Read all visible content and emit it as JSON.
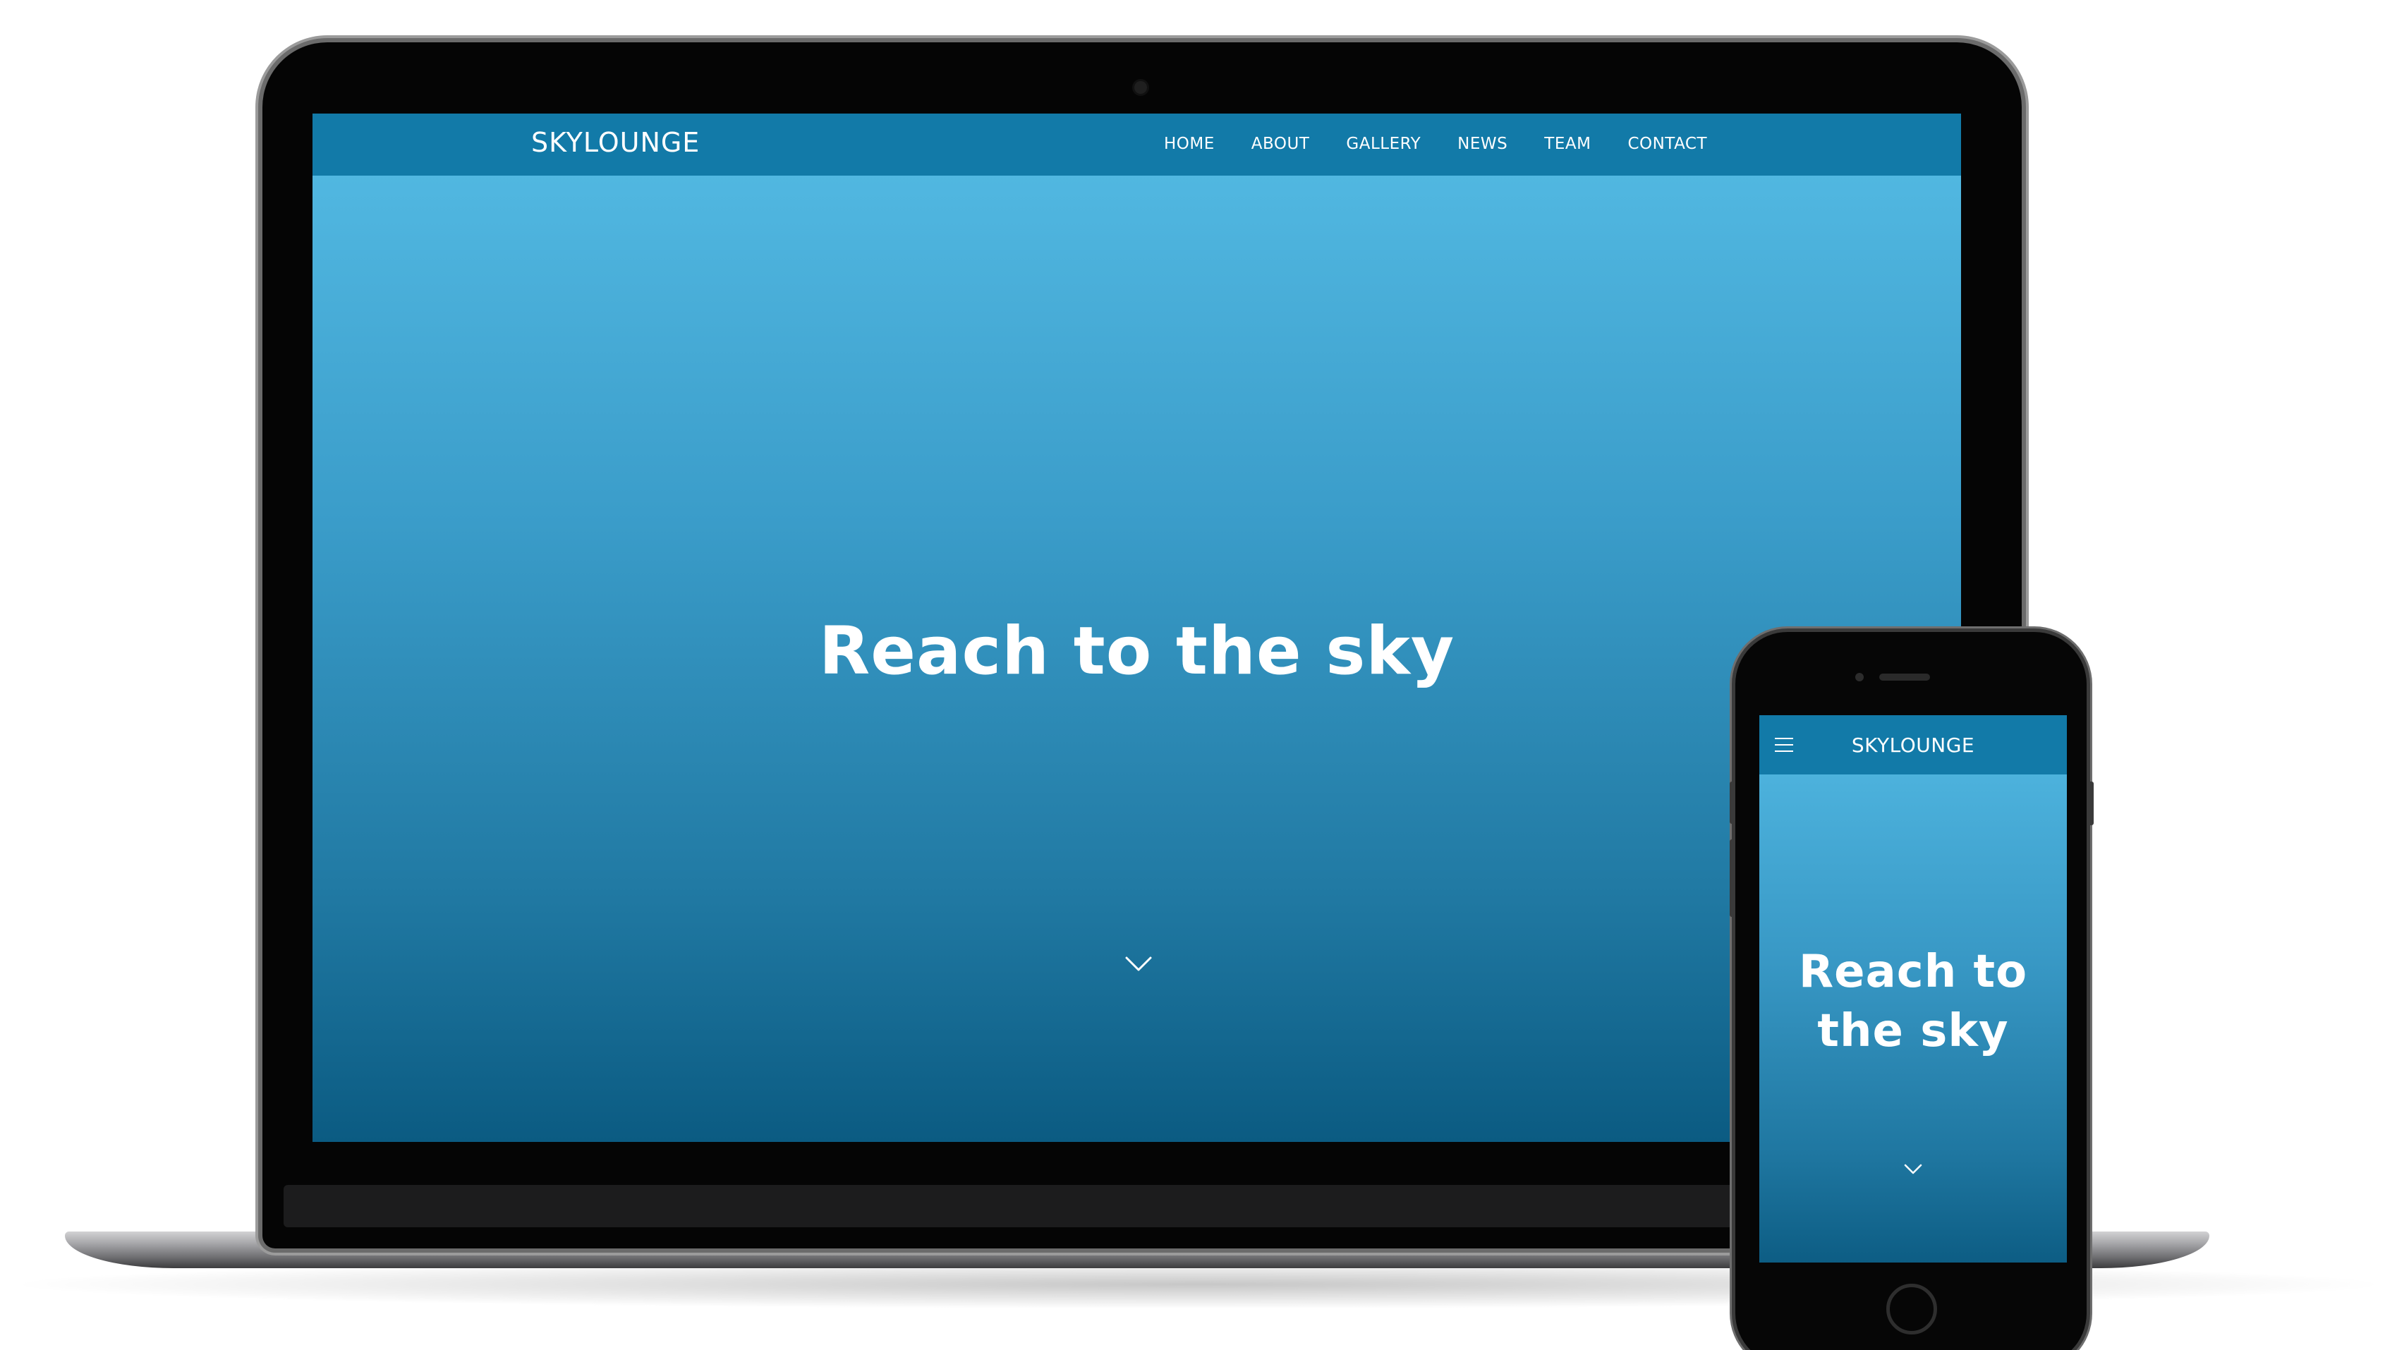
{
  "desktop": {
    "brand": "SKYLOUNGE",
    "nav_items": [
      "HOME",
      "ABOUT",
      "GALLERY",
      "NEWS",
      "TEAM",
      "CONTACT"
    ],
    "hero_title": "Reach to the sky",
    "scroll_icon": "chevron-down-icon"
  },
  "mobile": {
    "brand": "SKYLOUNGE",
    "menu_icon": "hamburger-menu-icon",
    "hero_title": "Reach to the sky",
    "scroll_icon": "chevron-down-icon"
  },
  "colors": {
    "navbar": "#127aa8",
    "hero_top": "#55bce5",
    "hero_bottom": "#0b5b82",
    "text": "#ffffff"
  }
}
